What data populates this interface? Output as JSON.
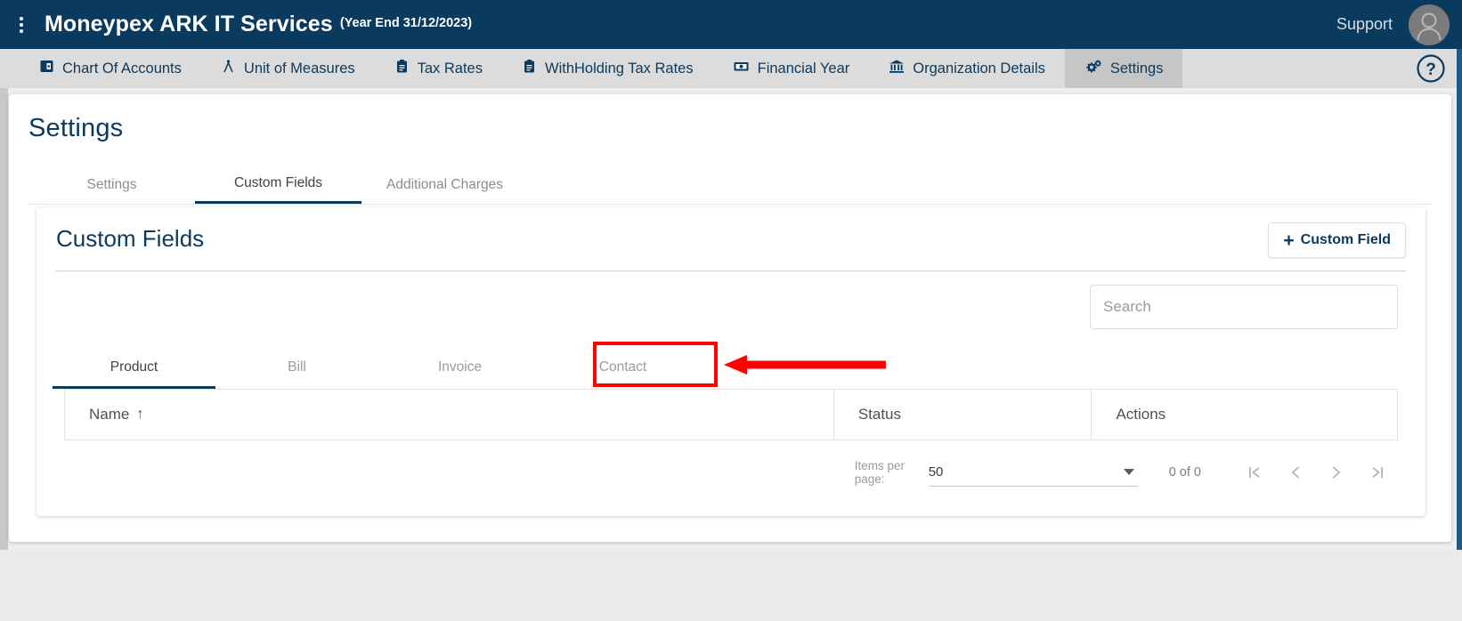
{
  "topbar": {
    "menu_icon": "kebab-menu-icon",
    "brand": "Moneypex ARK IT Services",
    "year_end": "(Year End 31/12/2023)",
    "support_label": "Support",
    "avatar_icon": "user-avatar-icon"
  },
  "nav": {
    "items": [
      {
        "label": "Chart Of Accounts",
        "icon": "chart-of-accounts-icon",
        "active": false
      },
      {
        "label": "Unit of Measures",
        "icon": "unit-of-measures-icon",
        "active": false
      },
      {
        "label": "Tax Rates",
        "icon": "clipboard-icon",
        "active": false
      },
      {
        "label": "WithHolding Tax Rates",
        "icon": "clipboard-icon",
        "active": false
      },
      {
        "label": "Financial Year",
        "icon": "banknote-icon",
        "active": false
      },
      {
        "label": "Organization Details",
        "icon": "bank-building-icon",
        "active": false
      },
      {
        "label": "Settings",
        "icon": "gears-icon",
        "active": true
      }
    ],
    "help_icon": "question-mark-circle-icon"
  },
  "page": {
    "title": "Settings",
    "tabs": [
      {
        "label": "Settings",
        "active": false
      },
      {
        "label": "Custom Fields",
        "active": true
      },
      {
        "label": "Additional Charges",
        "active": false
      }
    ]
  },
  "panel": {
    "title": "Custom Fields",
    "add_button": {
      "plus": "+",
      "label": "Custom Field"
    },
    "search": {
      "value": "",
      "placeholder": "Search"
    },
    "tabs": [
      {
        "label": "Product",
        "active": true
      },
      {
        "label": "Bill",
        "active": false
      },
      {
        "label": "Invoice",
        "active": false
      },
      {
        "label": "Contact",
        "active": false,
        "highlighted": true
      }
    ],
    "table": {
      "columns": [
        {
          "label": "Name",
          "sort_icon": "↑"
        },
        {
          "label": "Status"
        },
        {
          "label": "Actions"
        }
      ],
      "rows": []
    },
    "paginator": {
      "items_per_page_label": "Items per page:",
      "items_per_page_value": "50",
      "range_label": "0 of 0",
      "first_page_icon": "first-page-icon",
      "prev_page_icon": "previous-page-icon",
      "next_page_icon": "next-page-icon",
      "last_page_icon": "last-page-icon"
    }
  },
  "annotation": {
    "highlight_color": "#ff0000",
    "arrow_icon": "red-pointer-arrow"
  },
  "colors": {
    "brand_navy": "#0a3A5E",
    "nav_bg": "#dcdcdc",
    "nav_active_bg": "#c6c6c6",
    "page_bg": "#eeeeee"
  }
}
